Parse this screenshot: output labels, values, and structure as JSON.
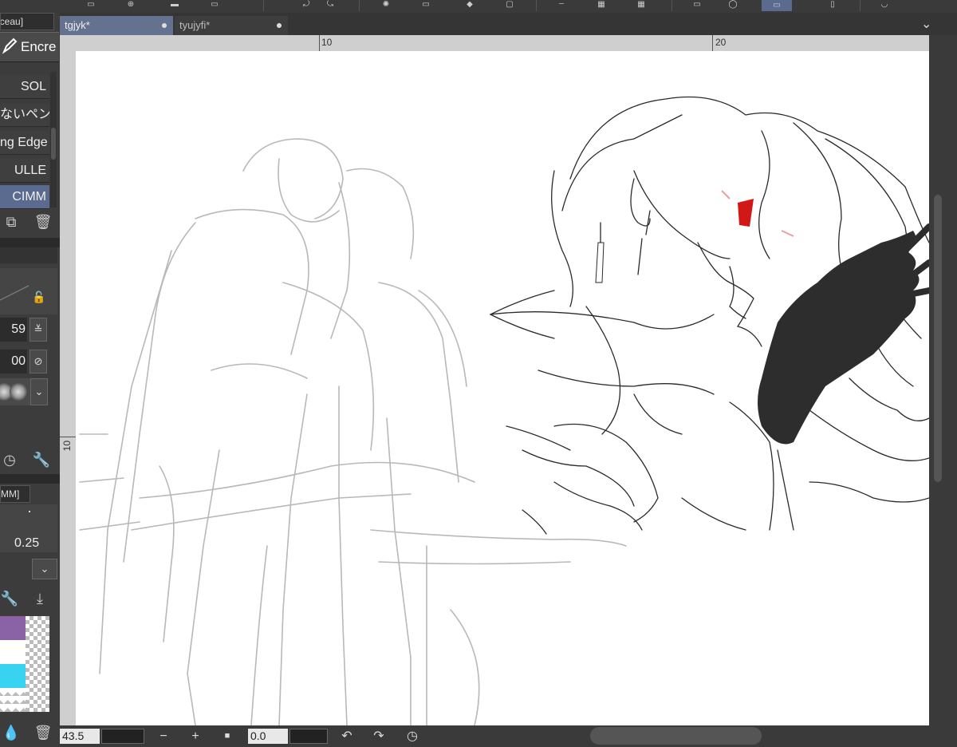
{
  "left_panel": {
    "sub_tool_tab": "nceau]",
    "tool_name": "Encre",
    "brushes": [
      {
        "label": "SOL",
        "selected": false
      },
      {
        "label": "ないペン",
        "selected": false
      },
      {
        "label": "ng Edge",
        "selected": false
      },
      {
        "label": "ULLE",
        "selected": false
      },
      {
        "label": "CIMM",
        "selected": true
      }
    ],
    "brush_size_value": "59",
    "opacity_value": "00",
    "panel_tab": "MM]",
    "tick_value": "0.25",
    "colors": {
      "swatch1": "#8a62a6",
      "swatch2": "#37d3f0",
      "selection": "#5b6a8f"
    }
  },
  "document_tabs": [
    {
      "label": "tgjyk*",
      "active": true
    },
    {
      "label": "tyujyfi*",
      "active": false
    }
  ],
  "ruler": {
    "top_labels": [
      "10",
      "20"
    ],
    "left_labels": [
      "10"
    ]
  },
  "bottom_bar": {
    "zoom": "43.5",
    "rotation": "0.0",
    "minus": "−",
    "plus": "+",
    "stop": "■"
  },
  "canvas": {
    "description_label": ""
  }
}
